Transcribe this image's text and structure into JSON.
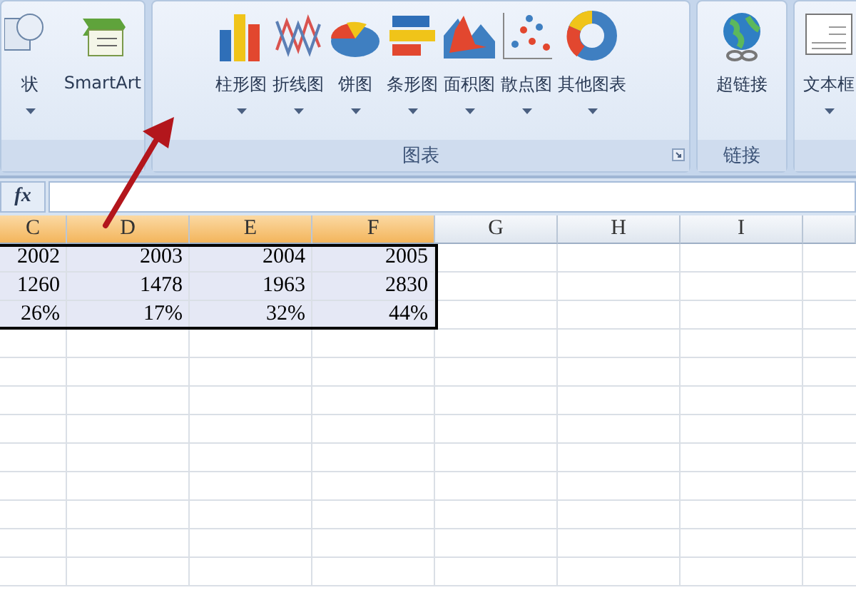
{
  "ribbon": {
    "groups": [
      {
        "launcher": false,
        "buttons": [
          {
            "label": "状",
            "kind": "shapes",
            "dropdown": true
          },
          {
            "label": "SmartArt",
            "kind": "smartart",
            "dropdown": false
          }
        ]
      },
      {
        "label": "图表",
        "launcher": true,
        "buttons": [
          {
            "label": "柱形图",
            "kind": "column",
            "dropdown": true
          },
          {
            "label": "折线图",
            "kind": "line",
            "dropdown": true
          },
          {
            "label": "饼图",
            "kind": "pie",
            "dropdown": true
          },
          {
            "label": "条形图",
            "kind": "bar",
            "dropdown": true
          },
          {
            "label": "面积图",
            "kind": "area",
            "dropdown": true
          },
          {
            "label": "散点图",
            "kind": "scatter",
            "dropdown": true
          },
          {
            "label": "其他图表",
            "kind": "donut",
            "dropdown": true
          }
        ]
      },
      {
        "label": "链接",
        "launcher": false,
        "buttons": [
          {
            "label": "超链接",
            "kind": "globe",
            "dropdown": false
          }
        ]
      },
      {
        "launcher": false,
        "buttons": [
          {
            "label": "文本框",
            "kind": "textbox",
            "dropdown": true
          }
        ]
      }
    ]
  },
  "formula_bar": {
    "function_label": "fx"
  },
  "sheet": {
    "columns": [
      {
        "label": "C",
        "selected": true
      },
      {
        "label": "D",
        "selected": true
      },
      {
        "label": "E",
        "selected": true
      },
      {
        "label": "F",
        "selected": true
      },
      {
        "label": "G",
        "selected": false
      },
      {
        "label": "H",
        "selected": false
      },
      {
        "label": "I",
        "selected": false
      }
    ],
    "rows": [
      {
        "cells": [
          "2002",
          "2003",
          "2004",
          "2005"
        ]
      },
      {
        "cells": [
          "1260",
          "1478",
          "1963",
          "2830"
        ]
      },
      {
        "cells": [
          "26%",
          "17%",
          "32%",
          "44%"
        ]
      }
    ]
  }
}
